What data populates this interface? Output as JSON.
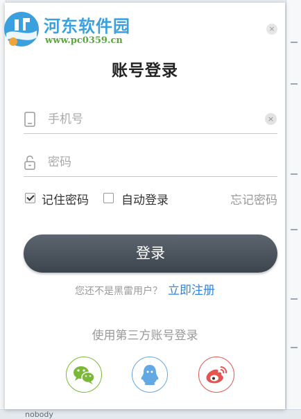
{
  "watermark": {
    "title": "河东软件园",
    "url": "www.pc0359.cn"
  },
  "dialog": {
    "title": "账号登录",
    "close_label": "×"
  },
  "form": {
    "phone_placeholder": "手机号",
    "phone_clear": "×",
    "password_placeholder": "密码",
    "remember_label": "记住密码",
    "remember_checked": true,
    "auto_login_label": "自动登录",
    "auto_login_checked": false,
    "forgot_label": "忘记密码",
    "login_label": "登录"
  },
  "register": {
    "question": "您还不是黑雷用户？",
    "link": "立即注册"
  },
  "third_party": {
    "title": "使用第三方账号登录",
    "providers": [
      {
        "name": "wechat",
        "icon": "wechat-icon",
        "color": "#7ab836"
      },
      {
        "name": "qq",
        "icon": "qq-icon",
        "color": "#63a7e3"
      },
      {
        "name": "weibo",
        "icon": "weibo-icon",
        "color": "#e55450"
      }
    ]
  },
  "background": {
    "bottom_text": "nobody"
  }
}
